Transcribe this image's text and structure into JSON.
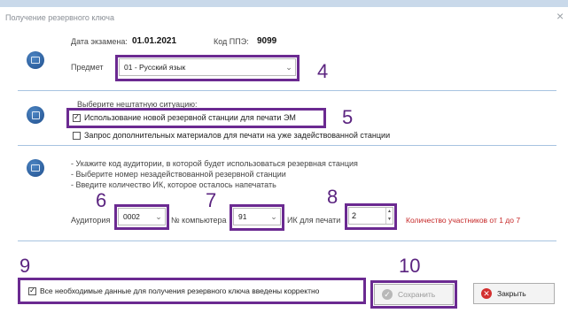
{
  "window": {
    "title": "Получение резервного ключа",
    "close_glyph": "×"
  },
  "exam": {
    "date_label": "Дата экзамена:",
    "date_value": "01.01.2021",
    "ppe_label": "Код ППЭ:",
    "ppe_value": "9099",
    "subject_label": "Предмет",
    "subject_value": "01 - Русский язык"
  },
  "situation": {
    "heading": "Выберите нештатную ситуацию:",
    "option1_label": "Использование новой резервной станции для печати ЭМ",
    "option1_checked": true,
    "option2_label": "Запрос дополнительных материалов для печати на уже задействованной станции",
    "option2_checked": false
  },
  "instructions": {
    "line1": "- Укажите код аудитории, в которой будет использоваться резервная станция",
    "line2": "- Выберите номер незадействованной резервной станции",
    "line3": "- Введите количество ИК, которое осталось напечатать"
  },
  "params": {
    "auditorium_label": "Аудитория",
    "auditorium_value": "0002",
    "computer_label": "№ компьютера",
    "computer_value": "91",
    "ik_label": "ИК для печати",
    "ik_value": "2",
    "range_hint": "Количество участников от 1 до 7"
  },
  "footer": {
    "confirm_label": "Все необходимые данные для получения резервного ключа введены корректно",
    "confirm_checked": true,
    "save_label": "Сохранить",
    "close_label": "Закрыть"
  },
  "annotations": [
    "4",
    "5",
    "6",
    "7",
    "8",
    "9",
    "10"
  ],
  "icons": {
    "section1": "calendar-icon",
    "section2": "copy-icon",
    "section3": "monitor-icon",
    "save": "check-circle-icon",
    "close": "close-circle-icon",
    "dropdown": "chevron-down-icon"
  },
  "colors": {
    "highlight_border": "#6b2a91",
    "annotation_text": "#5b2480",
    "warning_text": "#c62828",
    "close_icon": "#d32f2f",
    "section_divider": "#a7c3e0"
  }
}
